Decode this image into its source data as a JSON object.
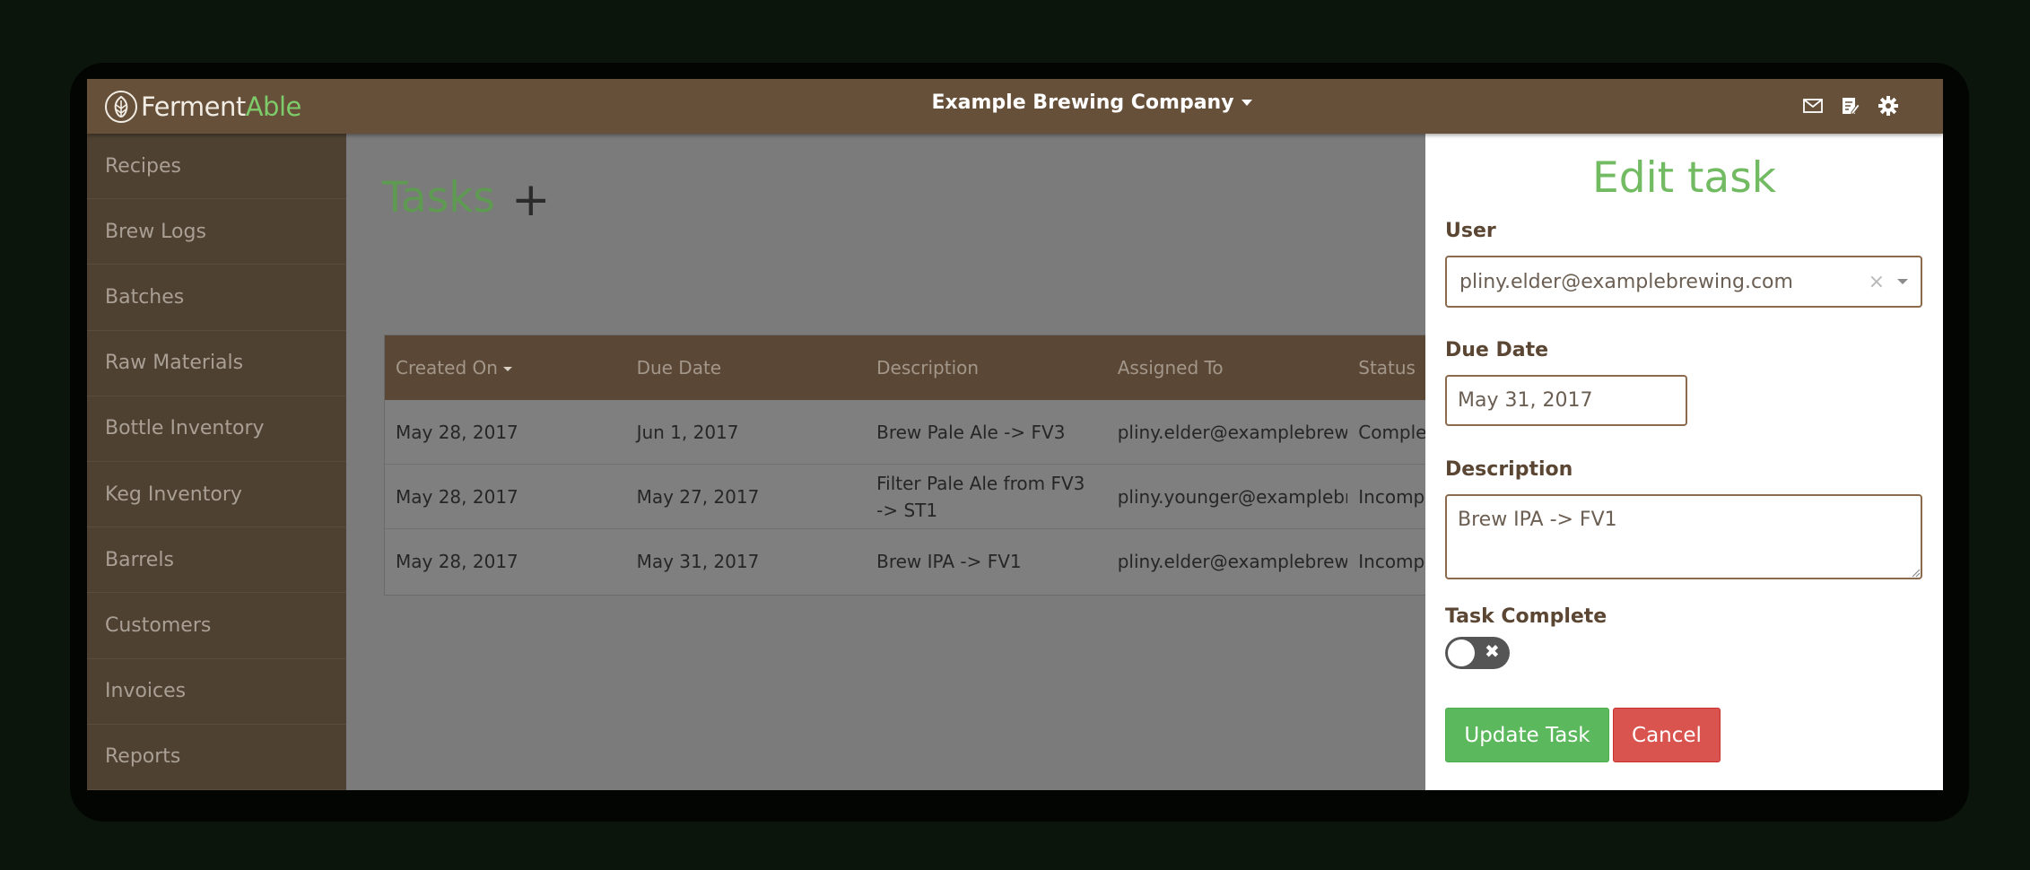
{
  "header": {
    "logo_part1": "Ferment",
    "logo_part2": "Able",
    "company": "Example Brewing Company",
    "icons": [
      "envelope-icon",
      "edit-note-icon",
      "gear-icon"
    ]
  },
  "sidebar": {
    "items": [
      {
        "label": "Recipes"
      },
      {
        "label": "Brew Logs"
      },
      {
        "label": "Batches"
      },
      {
        "label": "Raw Materials"
      },
      {
        "label": "Bottle Inventory"
      },
      {
        "label": "Keg Inventory"
      },
      {
        "label": "Barrels"
      },
      {
        "label": "Customers"
      },
      {
        "label": "Invoices"
      },
      {
        "label": "Reports"
      }
    ]
  },
  "main": {
    "title": "Tasks",
    "add_label": "+",
    "table": {
      "headers": [
        "Created On",
        "Due Date",
        "Description",
        "Assigned To",
        "Status"
      ],
      "rows": [
        {
          "created": "May 28, 2017",
          "due": "Jun 1, 2017",
          "description": "Brew Pale Ale -> FV3",
          "assigned": "pliny.elder@examplebrewi",
          "status": "Comple"
        },
        {
          "created": "May 28, 2017",
          "due": "May 27, 2017",
          "description": "Filter Pale Ale from FV3 -> ST1",
          "assigned": "pliny.younger@examplebr",
          "status": "Incompl"
        },
        {
          "created": "May 28, 2017",
          "due": "May 31, 2017",
          "description": "Brew IPA -> FV1",
          "assigned": "pliny.elder@examplebrewi",
          "status": "Incompl"
        }
      ]
    }
  },
  "panel": {
    "title": "Edit task",
    "user_label": "User",
    "user_value": "pliny.elder@examplebrewing.com",
    "clear_glyph": "×",
    "due_label": "Due Date",
    "due_value": "May 31, 2017",
    "desc_label": "Description",
    "desc_value": "Brew IPA -> FV1",
    "complete_label": "Task Complete",
    "toggle_off_glyph": "✖",
    "update_button": "Update Task",
    "cancel_button": "Cancel"
  },
  "colors": {
    "topbar": "#66503a",
    "sidebar": "#4e4132",
    "accent_green": "#72bb62",
    "update_green": "#5cb85c",
    "cancel_red": "#d9534f"
  }
}
